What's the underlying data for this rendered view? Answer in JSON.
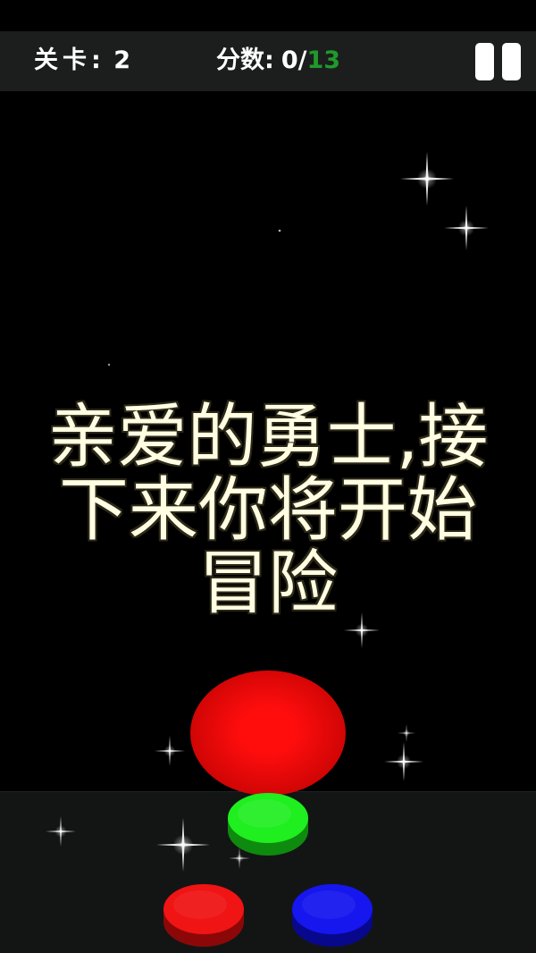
{
  "hud": {
    "level_label": "关卡:",
    "level_value": "2",
    "score_label": "分数:",
    "score_current": "0",
    "score_separator": "/",
    "score_target": "13",
    "pause_icon": "pause-icon"
  },
  "message": {
    "lines": [
      "亲爱的勇士,接",
      "下来你将开始",
      "冒险"
    ]
  },
  "falling_ball": {
    "color": "#ff0d0d",
    "edge_color": "#b20000"
  },
  "color_buttons": [
    {
      "icon": "green-disc",
      "top_color": "#1fee1f",
      "side_color": "#0e8a0e"
    },
    {
      "icon": "red-disc",
      "top_color": "#f01414",
      "side_color": "#8c0808"
    },
    {
      "icon": "blue-disc",
      "top_color": "#1616ee",
      "side_color": "#08088c"
    }
  ],
  "colors": {
    "background": "#000000",
    "hud_background": "#1c1e1e",
    "panel_background": "#131515",
    "hud_text": "#ffffff",
    "score_target": "#1f9a2a",
    "message_text": "#fffde2",
    "message_outline": "#2b2818"
  }
}
